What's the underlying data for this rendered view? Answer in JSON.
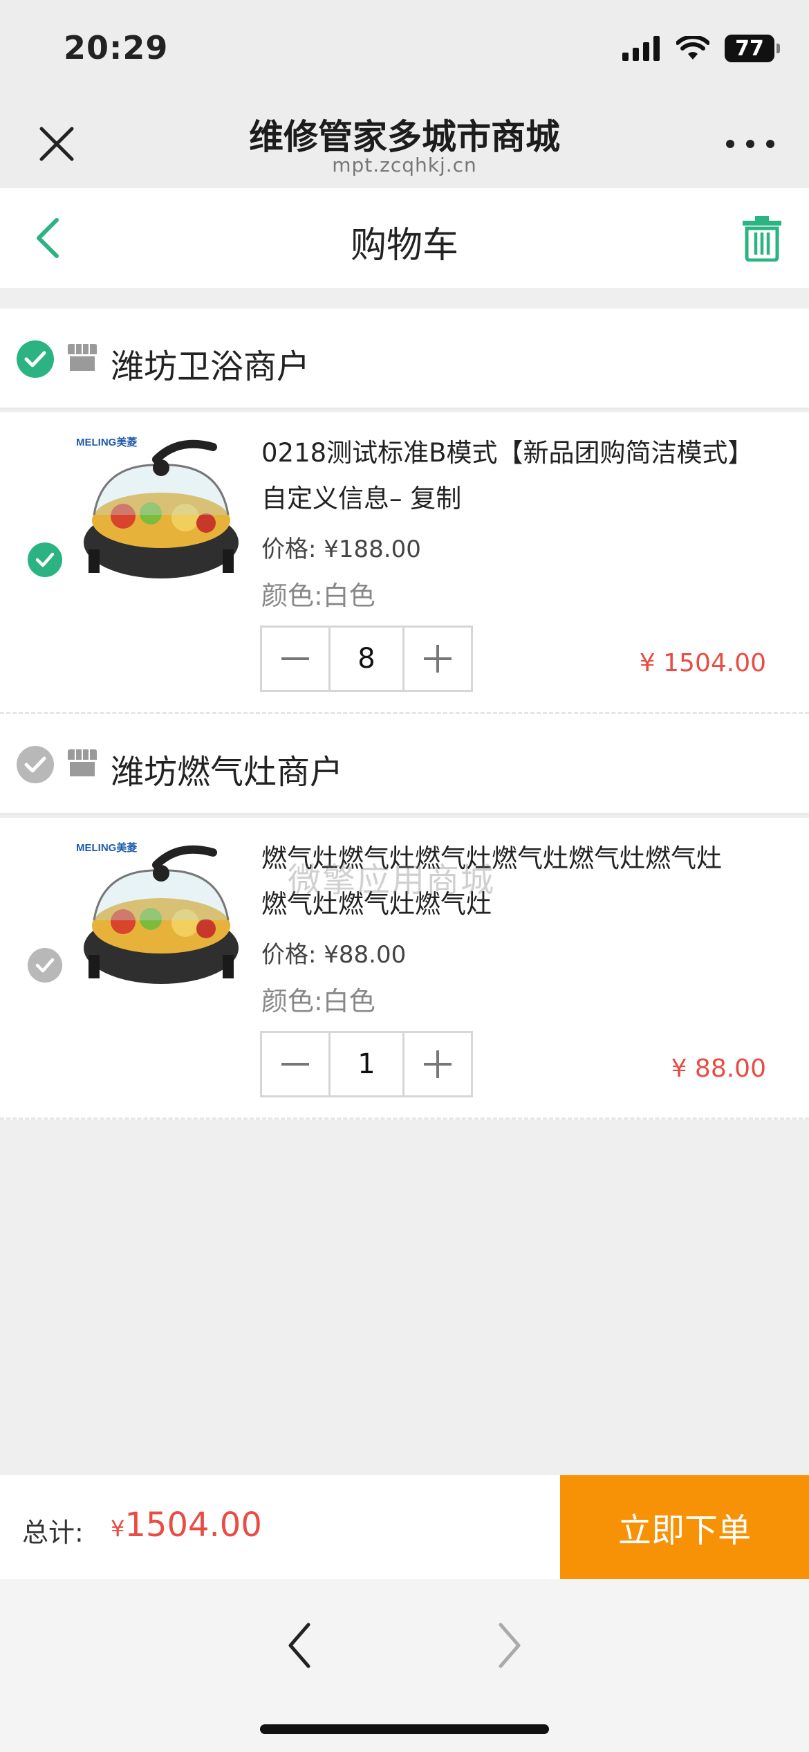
{
  "status_bar": {
    "time": "20:29",
    "battery": "77"
  },
  "browser": {
    "title": "维修管家多城市商城",
    "url": "mpt.zcqhkj.cn"
  },
  "navbar": {
    "title": "购物车"
  },
  "colors": {
    "accent": "#2bb381",
    "price": "#e84c43",
    "order_button": "#f79206",
    "unchecked": "#b8b8b8"
  },
  "shops": [
    {
      "name": "潍坊卫浴商户",
      "checked": true,
      "items": [
        {
          "name": "0218测试标准B模式【新品团购简洁模式】自定义信息– 复制",
          "price": "价格: ¥188.00",
          "color": "颜色:白色",
          "quantity": "8",
          "subtotal": "¥ 1504.00",
          "checked": true
        }
      ]
    },
    {
      "name": "潍坊燃气灶商户",
      "checked": false,
      "items": [
        {
          "name": "燃气灶燃气灶燃气灶燃气灶燃气灶燃气灶燃气灶燃气灶燃气灶",
          "price": "价格: ¥88.00",
          "color": "颜色:白色",
          "quantity": "1",
          "subtotal": "¥ 88.00",
          "checked": false
        }
      ]
    }
  ],
  "watermark": "微擎应用商城",
  "footer": {
    "total_label": "总计:",
    "currency": "¥",
    "total_amount": "1504.00",
    "order_button": "立即下单"
  }
}
